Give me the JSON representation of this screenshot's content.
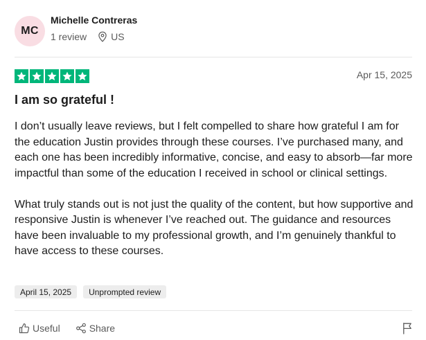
{
  "reviewer": {
    "initials": "MC",
    "name": "Michelle Contreras",
    "reviews_count": "1 review",
    "country": "US"
  },
  "review": {
    "rating": 5,
    "date": "Apr 15, 2025",
    "title": "I am so grateful !",
    "paragraphs": [
      "I don’t usually leave reviews, but I felt compelled to share how grateful I am for the education Justin provides through these courses. I’ve purchased many, and each one has been incredibly informative, concise, and easy to absorb—far more impactful than some of the education I received in school or clinical settings.",
      "What truly stands out is not just the quality of the content, but how supportive and responsive Justin is whenever I’ve reached out. The guidance and resources have been invaluable to my professional growth, and I’m genuinely thankful to have access to these courses."
    ],
    "date_of_experience": "April 15, 2025",
    "tag": "Unprompted review"
  },
  "actions": {
    "useful_label": "Useful",
    "share_label": "Share"
  },
  "colors": {
    "star_green": "#00b67a",
    "avatar_bg": "#f9dde3",
    "chip_bg": "#ededed"
  },
  "icons": [
    "star-icon",
    "location-pin-icon",
    "thumbs-up-icon",
    "share-icon",
    "flag-icon"
  ]
}
